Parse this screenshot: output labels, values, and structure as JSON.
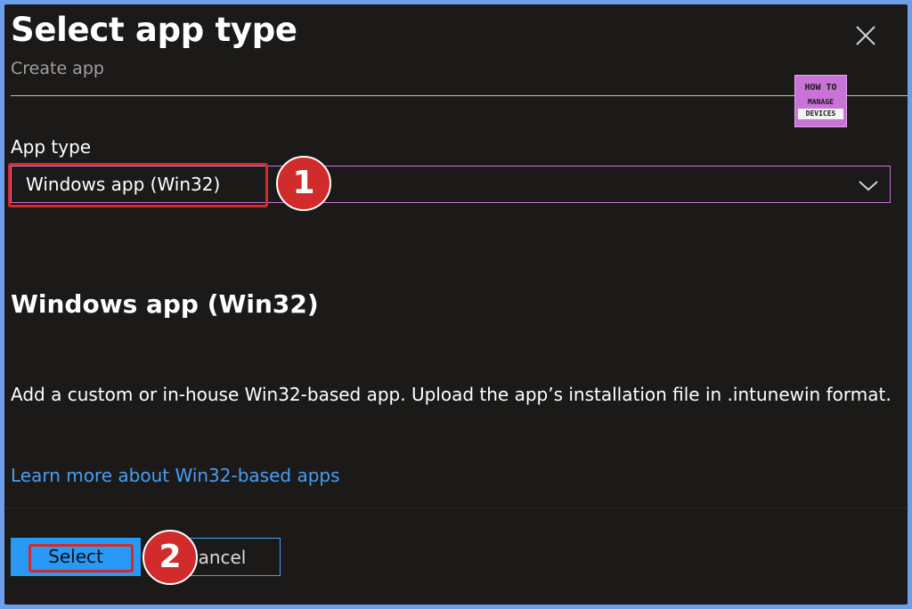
{
  "header": {
    "title": "Select app type",
    "subtitle": "Create app",
    "close_icon": "close-icon"
  },
  "logo": {
    "line1": "HOW TO",
    "line2": "MANAGE",
    "line3": "DEVICES"
  },
  "form": {
    "app_type_label": "App type",
    "app_type_value": "Windows app (Win32)",
    "dropdown_icon": "chevron-down-icon"
  },
  "details": {
    "heading": "Windows app (Win32)",
    "description": "Add a custom or in-house Win32-based app. Upload the app’s installation file in .intunewin format.",
    "learn_more": "Learn more about Win32-based apps"
  },
  "footer": {
    "select_label": "Select",
    "cancel_label": "Cancel"
  },
  "annotations": {
    "step1": "1",
    "step2": "2"
  },
  "colors": {
    "background": "#1b1a19",
    "primary": "#2899f5",
    "link": "#479ef5",
    "highlight": "#d52a2a",
    "focus_border": "#c774d6"
  }
}
